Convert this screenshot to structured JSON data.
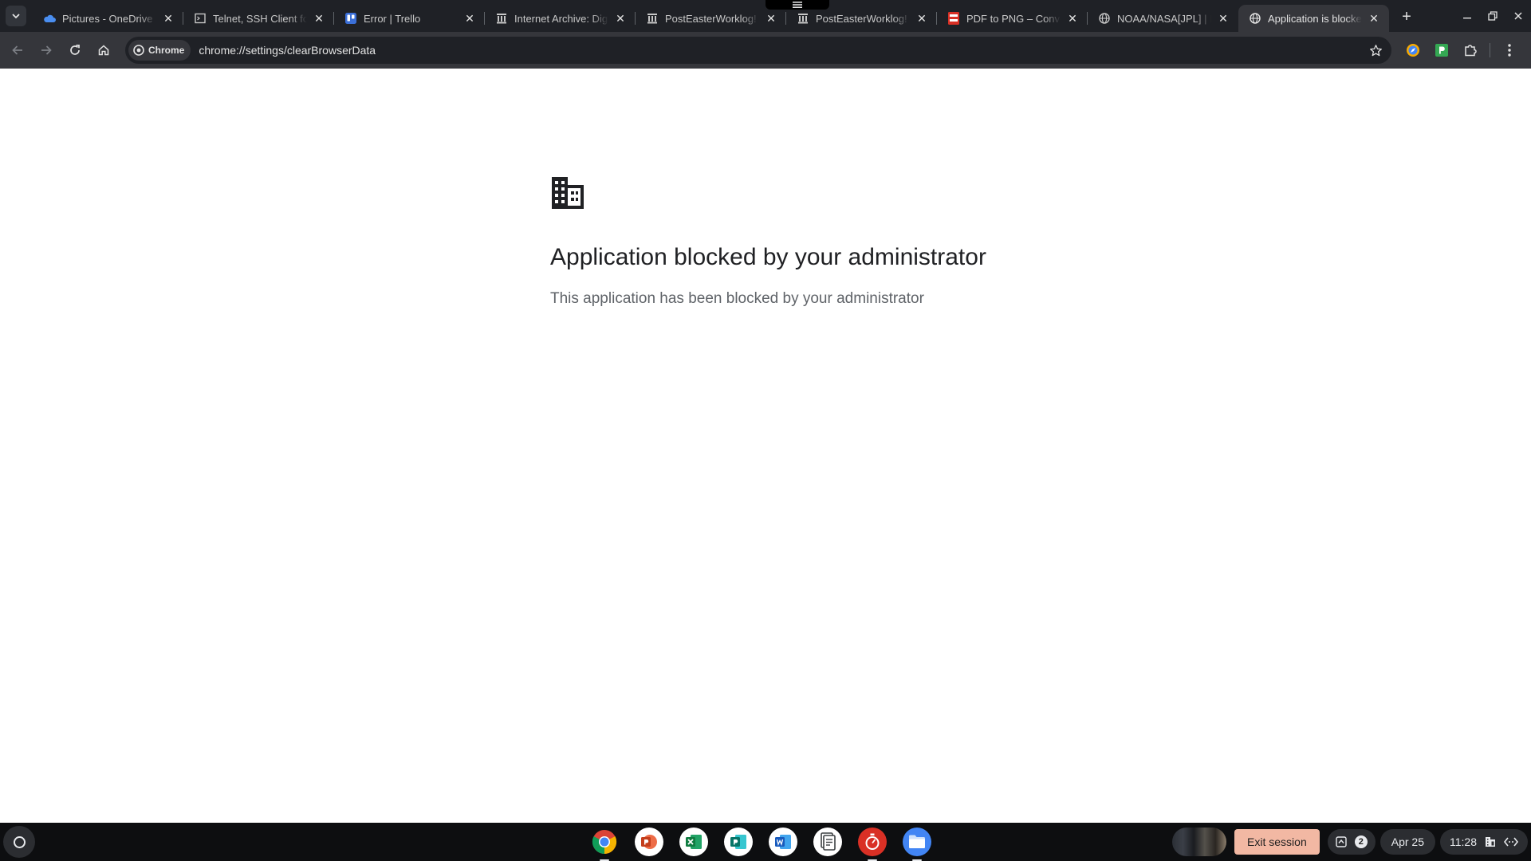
{
  "browser": {
    "tabs": [
      {
        "title": "Pictures - OneDrive",
        "favicon": "onedrive-icon"
      },
      {
        "title": "Telnet, SSH Client for Linux",
        "favicon": "terminal-icon"
      },
      {
        "title": "Error | Trello",
        "favicon": "trello-icon"
      },
      {
        "title": "Internet Archive: Digital Library",
        "favicon": "archive-icon"
      },
      {
        "title": "PostEasterWorklog! S",
        "favicon": "archive-icon"
      },
      {
        "title": "PostEasterWorklog! S",
        "favicon": "archive-icon"
      },
      {
        "title": "PDF to PNG – Convert",
        "favicon": "pdf-png-icon"
      },
      {
        "title": "NOAA/NASA[JPL] | Re",
        "favicon": "globe-icon"
      },
      {
        "title": "Application is blocked",
        "favicon": "globe-icon",
        "active": true
      }
    ],
    "toolbar": {
      "chip_label": "Chrome",
      "url": "chrome://settings/clearBrowserData"
    }
  },
  "page": {
    "title": "Application blocked by your administrator",
    "description": "This application has been blocked by your administrator",
    "icon": "business-building-icon"
  },
  "shelf": {
    "apps": [
      "chrome-icon",
      "powerpoint-icon",
      "excel-icon",
      "publisher-icon",
      "word-icon",
      "docs-icon",
      "stopwatch-icon",
      "files-icon"
    ],
    "exit_session_label": "Exit session",
    "notification_count": "2",
    "date": "Apr 25",
    "time": "11:28"
  },
  "colors": {
    "tabstrip_bg": "#1f2126",
    "toolbar_bg": "#35363b",
    "omnibox_bg": "#1f2126",
    "shelf_bg": "#0d0e10",
    "exit_button": "#f2b8a3"
  }
}
